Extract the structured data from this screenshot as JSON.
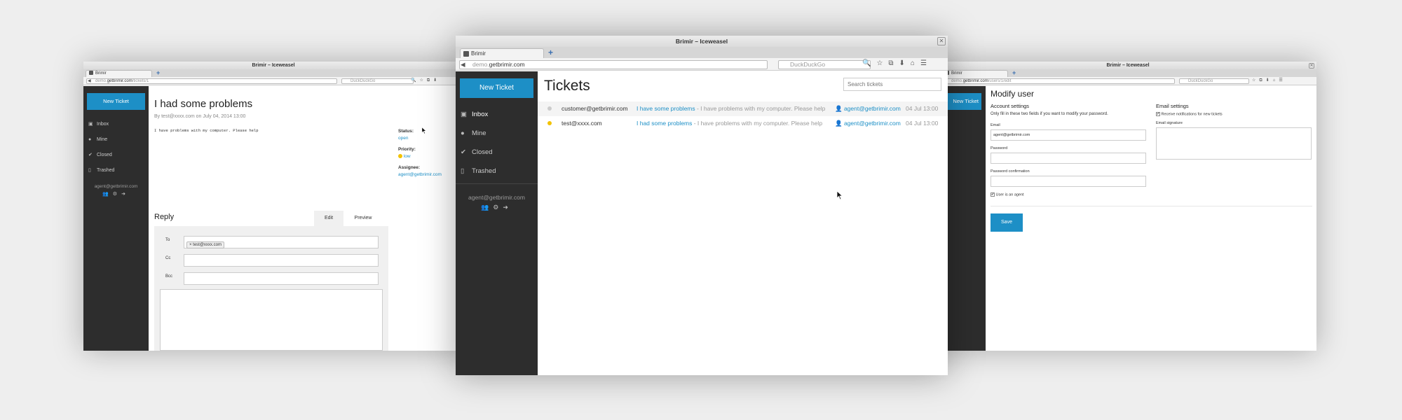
{
  "browser": {
    "window_title": "Brimir – Iceweasel",
    "tab_label": "Brimir",
    "search_engine": "DuckDuckGo",
    "close_symbol": "✕"
  },
  "left": {
    "url_prefix": "demo.",
    "url_host": "getbrimir.com",
    "url_path": "/tickets/1",
    "new_ticket": "New Ticket",
    "sidebar": [
      {
        "icon": "inbox-icon",
        "label": "Inbox"
      },
      {
        "icon": "person-icon",
        "label": "Mine"
      },
      {
        "icon": "check-icon",
        "label": "Closed"
      },
      {
        "icon": "trash-icon",
        "label": "Trashed"
      }
    ],
    "user_email": "agent@getbrimir.com",
    "ticket_title": "I had some problems",
    "ticket_meta": "By test@xxxx.com on July 04, 2014 13:00",
    "ticket_body": "I have problems with my computer. Please help",
    "status_label": "Status:",
    "status_value": "open",
    "priority_label": "Priority:",
    "priority_value": "low",
    "assignee_label": "Assignee:",
    "assignee_value": "agent@getbrimir.com",
    "reply_title": "Reply",
    "edit_tab": "Edit",
    "preview_tab": "Preview",
    "to_label": "To",
    "to_tag": "test@xxxx.com",
    "cc_label": "Cc",
    "bcc_label": "Bcc"
  },
  "center": {
    "url_prefix": "demo.",
    "url_host": "getbrimir.com",
    "new_ticket": "New Ticket",
    "sidebar": [
      {
        "icon": "inbox-icon",
        "label": "Inbox"
      },
      {
        "icon": "person-icon",
        "label": "Mine"
      },
      {
        "icon": "check-icon",
        "label": "Closed"
      },
      {
        "icon": "trash-icon",
        "label": "Trashed"
      }
    ],
    "user_email": "agent@getbrimir.com",
    "page_title": "Tickets",
    "search_placeholder": "Search tickets",
    "tickets": [
      {
        "from": "customer@getbrimir.com",
        "subject": "I have some problems",
        "preview": " - I have problems with my computer. Please help",
        "assignee": "agent@getbrimir.com",
        "date": "04 Jul 13:00",
        "priority_color": "#cccccc"
      },
      {
        "from": "test@xxxx.com",
        "subject": "I had some problems",
        "preview": " - I have problems with my computer. Please help",
        "assignee": "agent@getbrimir.com",
        "date": "04 Jul 13:00",
        "priority_color": "#f2c200"
      }
    ]
  },
  "right": {
    "url_prefix": "demo.",
    "url_host": "getbrimir.com",
    "url_path": "/users/1/edit",
    "new_ticket": "New Ticket",
    "page_title": "Modify user",
    "account_heading": "Account settings",
    "account_note": "Only fill in these two fields if you want to modify your password.",
    "email_label": "Email",
    "email_value": "agent@getbrimir.com",
    "password_label": "Password",
    "password_confirm_label": "Password confirmation",
    "agent_label": "User is an agent",
    "email_settings_heading": "Email settings",
    "notify_label": "Receive notifications for new tickets",
    "signature_label": "Email signature",
    "save_button": "Save"
  }
}
